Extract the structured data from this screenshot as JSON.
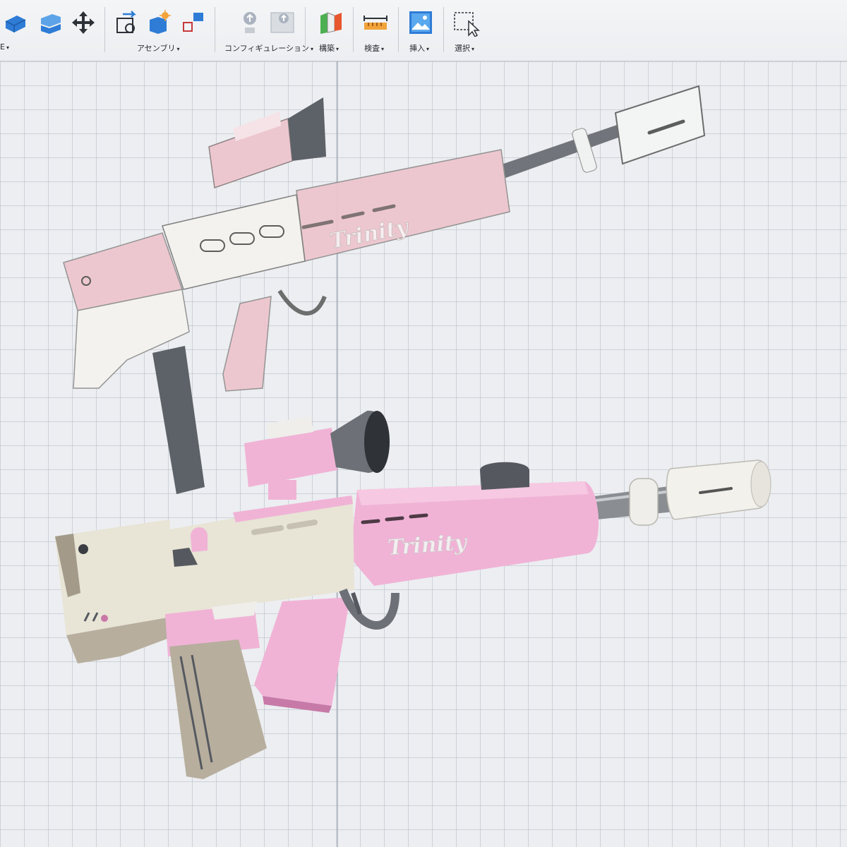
{
  "toolbar": {
    "groups": [
      {
        "label": "E",
        "caret": "▾"
      },
      {
        "label": "アセンブリ",
        "caret": "▾"
      },
      {
        "label": "コンフィギュレーション",
        "caret": "▾"
      },
      {
        "label": "構築",
        "caret": "▾"
      },
      {
        "label": "検査",
        "caret": "▾"
      },
      {
        "label": "挿入",
        "caret": "▾"
      },
      {
        "label": "選択",
        "caret": "▾"
      }
    ],
    "icons": [
      "extrude-icon",
      "sketch-icon",
      "move-icon",
      "new-component-icon",
      "joint-icon",
      "rigid-group-icon",
      "config-a-icon",
      "config-b-icon",
      "construct-plane-icon",
      "measure-icon",
      "insert-image-icon",
      "select-icon"
    ]
  },
  "canvas": {
    "reference_image_text": "Trinity",
    "model_text": "Trinity",
    "colors": {
      "pink": "#f0b3d6",
      "pink_ref": "#eec5cd",
      "cream": "#e8e4d6",
      "grey_dark": "#555a60",
      "metal": "#8a8d92"
    }
  }
}
